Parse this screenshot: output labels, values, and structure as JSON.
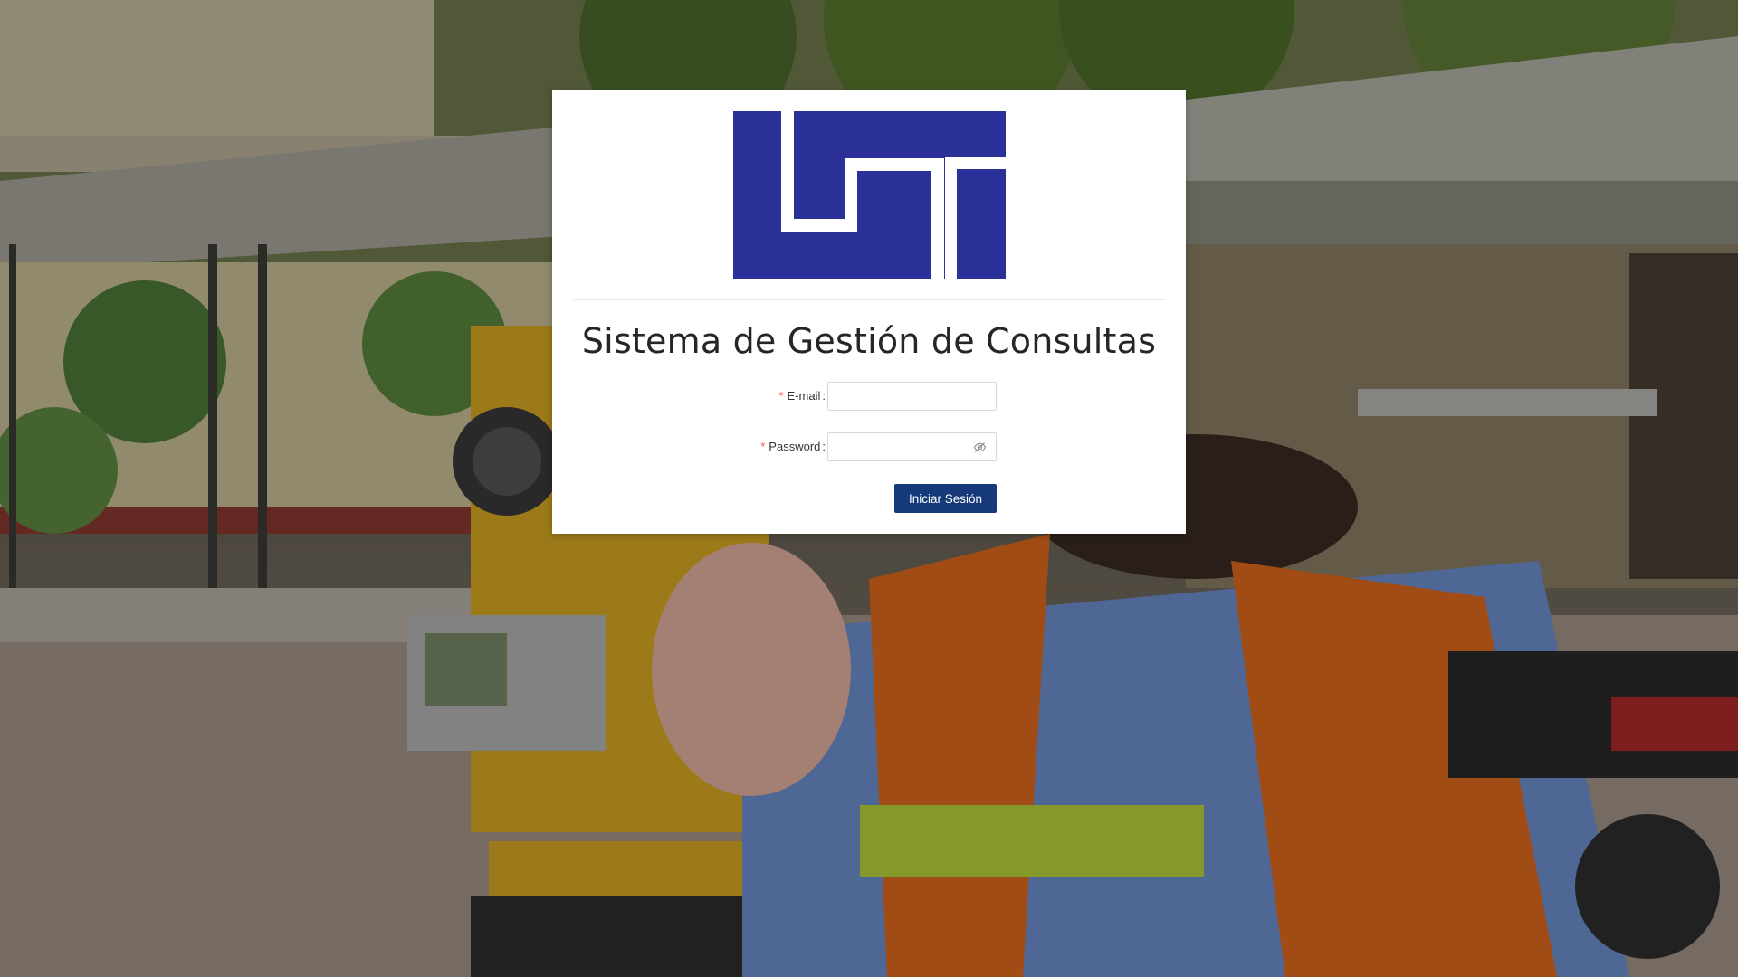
{
  "page": {
    "title": "Sistema de Gestión de Consultas"
  },
  "logo": {
    "name": "uni-logo-icon",
    "color": "#2b3099"
  },
  "form": {
    "email": {
      "required_mark": "*",
      "label": "E-mail",
      "value": "",
      "placeholder": ""
    },
    "password": {
      "required_mark": "*",
      "label": "Password",
      "value": "",
      "placeholder": "",
      "toggle_icon": "eye-invisible-icon"
    },
    "submit_label": "Iniciar Sesión"
  },
  "colors": {
    "primary_button": "#163a79",
    "required_mark": "#ff4d4f",
    "card_background": "#ffffff"
  }
}
